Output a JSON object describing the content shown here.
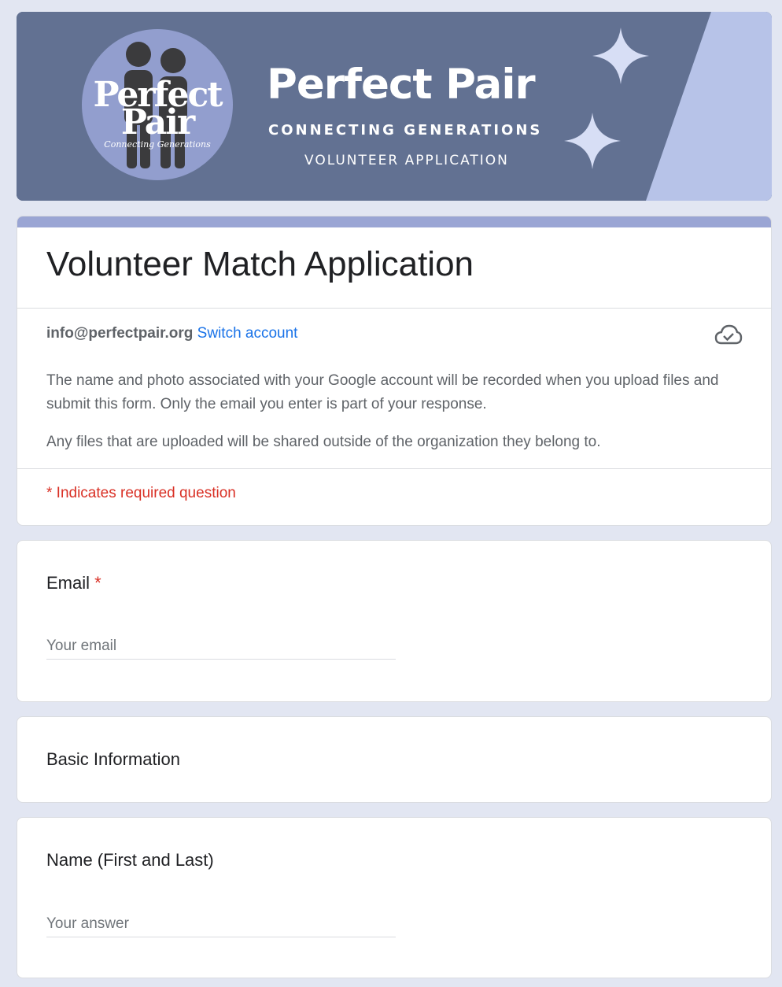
{
  "banner": {
    "logo_line1": "Perfect",
    "logo_line2": "Pair",
    "logo_tagline": "Connecting Generations",
    "title": "Perfect Pair",
    "subtitle": "CONNECTING GENERATIONS",
    "subtitle2": "VOLUNTEER APPLICATION",
    "icons": [
      "people-icon",
      "sparkle-icon",
      "sparkle-icon"
    ]
  },
  "form": {
    "title": "Volunteer Match Application",
    "account_email": "info@perfectpair.org",
    "switch_account": "Switch account",
    "cloud_icon": "cloud-saved-icon",
    "notice1": "The name and photo associated with your Google account will be recorded when you upload files and submit this form. Only the email you enter is part of your response.",
    "notice2": "Any files that are uploaded will be shared outside of the organization they belong to.",
    "required_note": "* Indicates required question"
  },
  "questions": {
    "email": {
      "label": "Email",
      "required_mark": "*",
      "placeholder": "Your email"
    },
    "section": {
      "label": "Basic Information"
    },
    "name": {
      "label": "Name (First and Last)",
      "placeholder": "Your answer"
    }
  },
  "colors": {
    "background": "#e2e6f2",
    "banner": "#627192",
    "accent": "#9aa5d4",
    "link": "#1a73e8",
    "required": "#d93025"
  }
}
